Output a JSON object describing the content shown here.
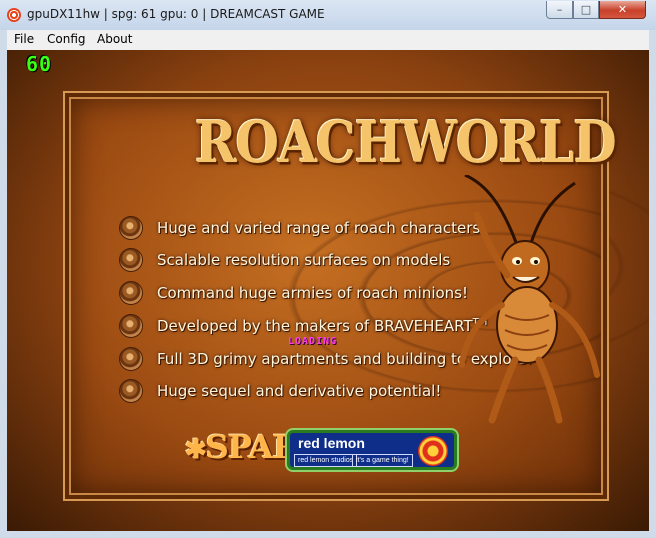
{
  "window": {
    "title": "gpuDX11hw | spg: 61 gpu: 0 | DREAMCAST GAME",
    "minimize_glyph": "–",
    "maximize_glyph": "□",
    "close_glyph": "✕"
  },
  "menu": {
    "items": [
      {
        "label": "File"
      },
      {
        "label": "Config"
      },
      {
        "label": "About"
      }
    ]
  },
  "game": {
    "fps": "60",
    "logo": "ROACHWORLD",
    "features": [
      {
        "text": "Huge and varied range of roach characters"
      },
      {
        "text": "Scalable resolution surfaces on models"
      },
      {
        "text": "Command huge armies of roach minions!"
      },
      {
        "text": "Developed by the makers of BRAVEHEART",
        "suffix": "TM"
      },
      {
        "text": "Full 3D grimy apartments and building to explore!"
      },
      {
        "text": "Huge sequel and derivative potential!"
      }
    ],
    "loading": "LOADING",
    "spark_logo": "SPARK",
    "red_lemon": {
      "title": "red lemon",
      "studios": "red lemon studios",
      "tagline": "it's a game thing!"
    }
  },
  "colors": {
    "fps": "#39ff14",
    "loading": "#ff3df0",
    "panel": "#9c4b12",
    "logo": "#f5c36a"
  }
}
